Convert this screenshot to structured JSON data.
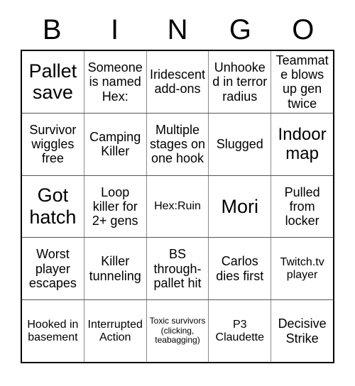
{
  "card": {
    "title": "Bingo Card",
    "header_letters": [
      "B",
      "I",
      "N",
      "G",
      "O"
    ],
    "columns": 5,
    "rows": 5,
    "colors": {
      "background": "#ffffff",
      "text": "#000000",
      "outer_border": "#000000",
      "inner_border": "#8a8a8a"
    },
    "cells": [
      [
        {
          "text": "Pallet save",
          "size": "xl"
        },
        {
          "text": "Someone is named Hex:",
          "size": "md"
        },
        {
          "text": "Iridescent add-ons",
          "size": "md"
        },
        {
          "text": "Unhooked in terror radius",
          "size": "md"
        },
        {
          "text": "Teammate blows up gen twice",
          "size": "md"
        }
      ],
      [
        {
          "text": "Survivor wiggles free",
          "size": "md"
        },
        {
          "text": "Camping Killer",
          "size": "md"
        },
        {
          "text": "Multiple stages on one hook",
          "size": "md"
        },
        {
          "text": "Slugged",
          "size": "md"
        },
        {
          "text": "Indoor map",
          "size": "lg"
        }
      ],
      [
        {
          "text": "Got hatch",
          "size": "xl"
        },
        {
          "text": "Loop killer for 2+ gens",
          "size": "md"
        },
        {
          "text": "Hex:Ruin",
          "size": "sm"
        },
        {
          "text": "Mori",
          "size": "xl"
        },
        {
          "text": "Pulled from locker",
          "size": "md"
        }
      ],
      [
        {
          "text": "Worst player escapes",
          "size": "md"
        },
        {
          "text": "Killer tunneling",
          "size": "md"
        },
        {
          "text": "BS through-pallet hit",
          "size": "md"
        },
        {
          "text": "Carlos dies first",
          "size": "md"
        },
        {
          "text": "Twitch.tv player",
          "size": "sm"
        }
      ],
      [
        {
          "text": "Hooked in basement",
          "size": "sm"
        },
        {
          "text": "Interrupted Action",
          "size": "sm"
        },
        {
          "text": "Toxic survivors (clicking, teabagging)",
          "size": "xxs"
        },
        {
          "text": "P3 Claudette",
          "size": "sm"
        },
        {
          "text": "Decisive Strike",
          "size": "md"
        }
      ]
    ]
  }
}
